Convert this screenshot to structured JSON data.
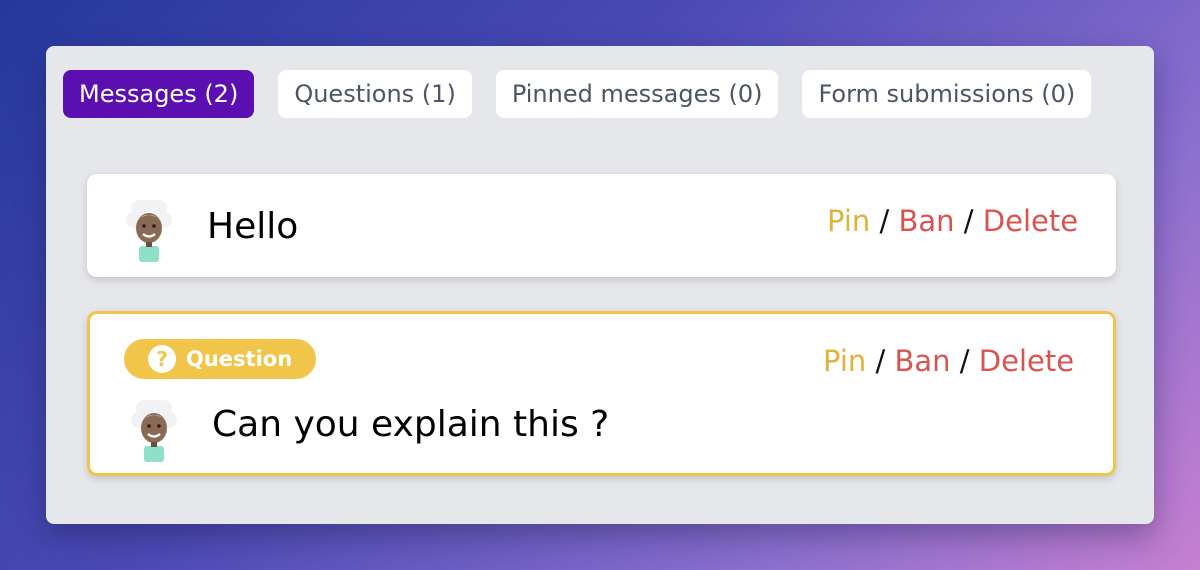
{
  "tabs": [
    {
      "label": "Messages (2)",
      "active": true
    },
    {
      "label": "Questions (1)",
      "active": false
    },
    {
      "label": "Pinned messages (0)",
      "active": false
    },
    {
      "label": "Form submissions (0)",
      "active": false
    }
  ],
  "messages": [
    {
      "type": "message",
      "text": "Hello",
      "actions": {
        "pin": "Pin",
        "ban": "Ban",
        "delete": "Delete",
        "separator": "/"
      }
    },
    {
      "type": "question",
      "badge": {
        "icon": "?",
        "label": "Question"
      },
      "text": "Can you explain this ?",
      "actions": {
        "pin": "Pin",
        "ban": "Ban",
        "delete": "Delete",
        "separator": "/"
      }
    }
  ],
  "colors": {
    "active_tab": "#5b0fb0",
    "pin": "#e0b23b",
    "ban_delete": "#d9534f",
    "question_accent": "#f1c54a"
  },
  "icons": {
    "avatar": "user-avatar-icon",
    "question_badge": "question-mark-icon"
  }
}
